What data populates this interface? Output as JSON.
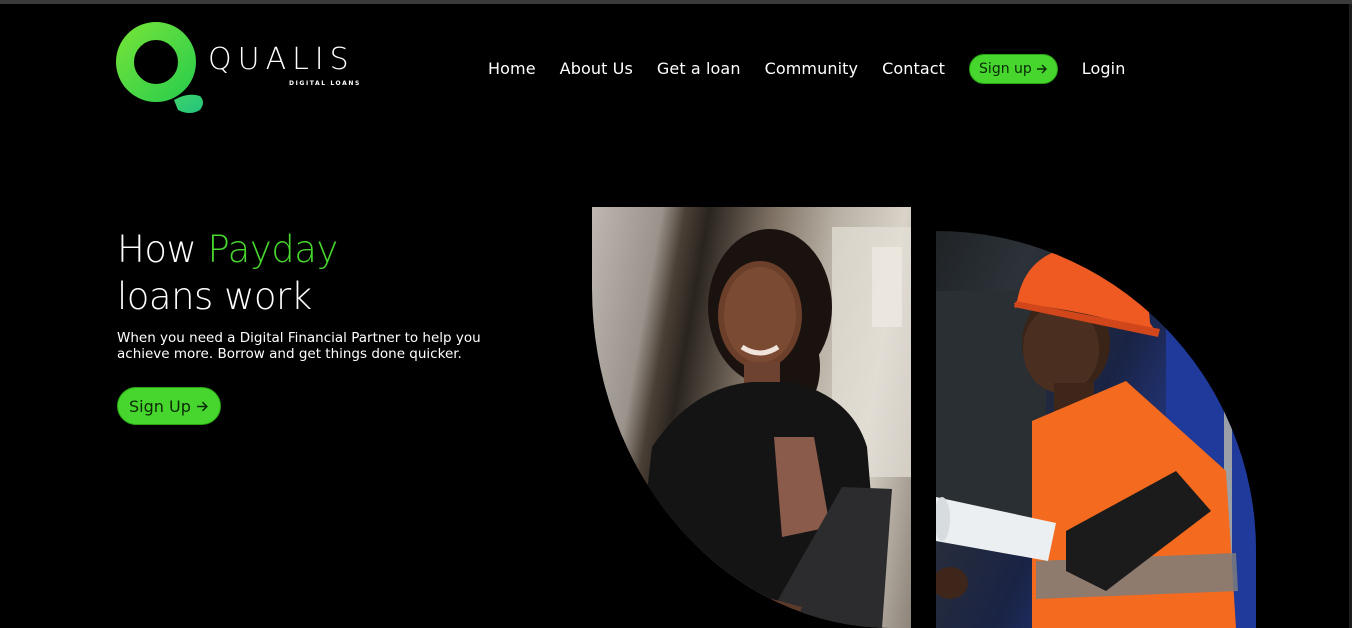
{
  "brand": {
    "name": "QUALIS",
    "tagline": "DIGITAL LOANS"
  },
  "nav": {
    "items": [
      "Home",
      "About Us",
      "Get a loan",
      "Community",
      "Contact"
    ],
    "signup_label": "Sign up",
    "login_label": "Login"
  },
  "hero": {
    "title_prefix": "How",
    "title_highlight": "Payday",
    "title_line2": "loans work",
    "description": "When you need a Digital Financial Partner to help you achieve more. Borrow and get things done quicker.",
    "cta_label": "Sign Up"
  },
  "colors": {
    "accent": "#46d62d",
    "background": "#000000"
  },
  "icons": {
    "cta_arrow": "arrow-right-icon"
  }
}
